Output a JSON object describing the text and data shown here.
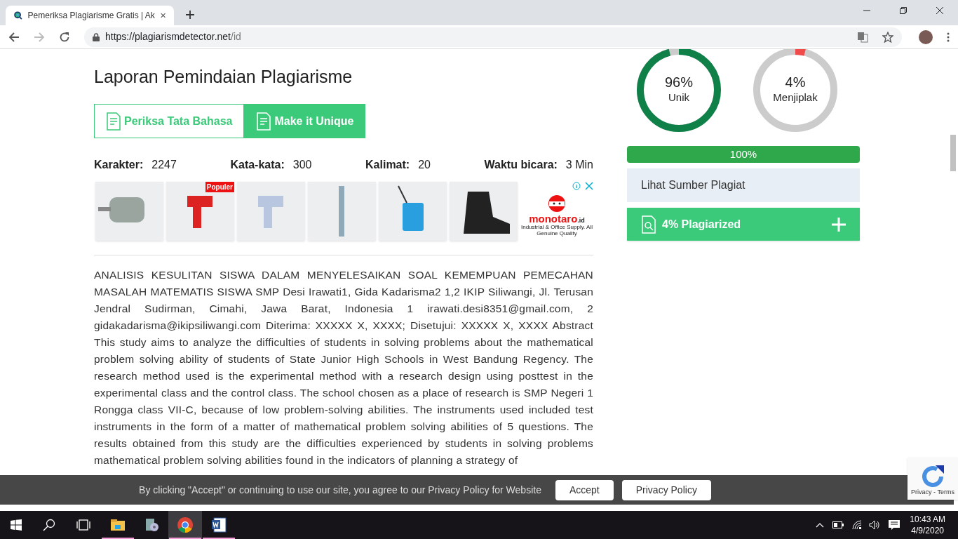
{
  "browser": {
    "tab_title": "Pemeriksa Plagiarisme Gratis | Ak",
    "url_host": "https://plagiarismdetector.net",
    "url_path": "/id"
  },
  "report": {
    "title": "Laporan Pemindaian Plagiarisme",
    "buttons": [
      {
        "label": "Periksa Tata Bahasa",
        "kind": "outline"
      },
      {
        "label": "Make it Unique",
        "kind": "filled"
      }
    ],
    "stats": [
      {
        "label": "Karakter:",
        "value": "2247"
      },
      {
        "label": "Kata-kata:",
        "value": "300"
      },
      {
        "label": "Kalimat:",
        "value": "20"
      },
      {
        "label": "Waktu bicara:",
        "value": "3 Min"
      }
    ],
    "ad": {
      "products": [
        {
          "kind": "motor"
        },
        {
          "kind": "thermometer",
          "badge": "Populer"
        },
        {
          "kind": "thermometer"
        },
        {
          "kind": "pump"
        },
        {
          "kind": "sprayer"
        },
        {
          "kind": "boot"
        }
      ],
      "brand": "monotaro",
      "brand_suffix": ".id",
      "tagline": "Industrial & Office Supply. All Genuine Quality"
    },
    "text": "ANALISIS KESULITAN SISWA DALAM MENYELESAIKAN SOAL KEMEMPUAN PEMECAHAN MASALAH MATEMATIS SISWA SMP Desi Irawati1, Gida Kadarisma2 1,2 IKIP Siliwangi, Jl. Terusan Jendral Sudirman, Cimahi, Jawa Barat, Indonesia 1 irawati.desi8351@gmail.com, 2 gidakadarisma@ikipsiliwangi.com Diterima: XXXXX X, XXXX; Disetujui: XXXXX X, XXXX Abstract This study aims to analyze the difficulties of students in solving problems about the mathematical problem solving ability of students of State Junior High Schools in West Bandung Regency. The research method used is the experimental method with a research design using posttest in the experimental class and the control class. The school chosen as a place of research is SMP Negeri 1 Rongga class VII-C, because of low problem-solving abilities. The instruments used included test instruments in the form of a matter of mathematical problem solving abilities of 5 questions. The results obtained from this study are the difficulties experienced by students in solving problems mathematical problem solving abilities found in the indicators of planning a strategy of"
  },
  "results": {
    "gauges": [
      {
        "percent": "96%",
        "label": "Unik",
        "level": 0.96,
        "color": "#0f8048"
      },
      {
        "percent": "4%",
        "label": "Menjiplak",
        "level": 0.04,
        "color": "#f04a4a"
      }
    ],
    "progress": {
      "level": 1,
      "reading": "100%"
    },
    "sources_title": "Lihat Sumber Plagiat",
    "plagiarized": {
      "label": "4% Plagiarized",
      "expanded": false
    }
  },
  "cookie_banner": {
    "text": "By clicking \"Accept\" or continuing to use our site, you agree to our Privacy Policy for Website",
    "buttons": [
      "Accept",
      "Privacy Policy"
    ]
  },
  "recaptcha": {
    "text": "Privacy - Terms"
  },
  "taskbar": {
    "apps": [
      {
        "kind": "explorer",
        "active": false,
        "running": true
      },
      {
        "kind": "installer",
        "active": false,
        "running": false
      },
      {
        "kind": "chrome",
        "active": true,
        "running": true
      },
      {
        "kind": "word",
        "active": false,
        "running": true
      }
    ],
    "time": "10:43 AM",
    "date": "4/9/2020"
  }
}
